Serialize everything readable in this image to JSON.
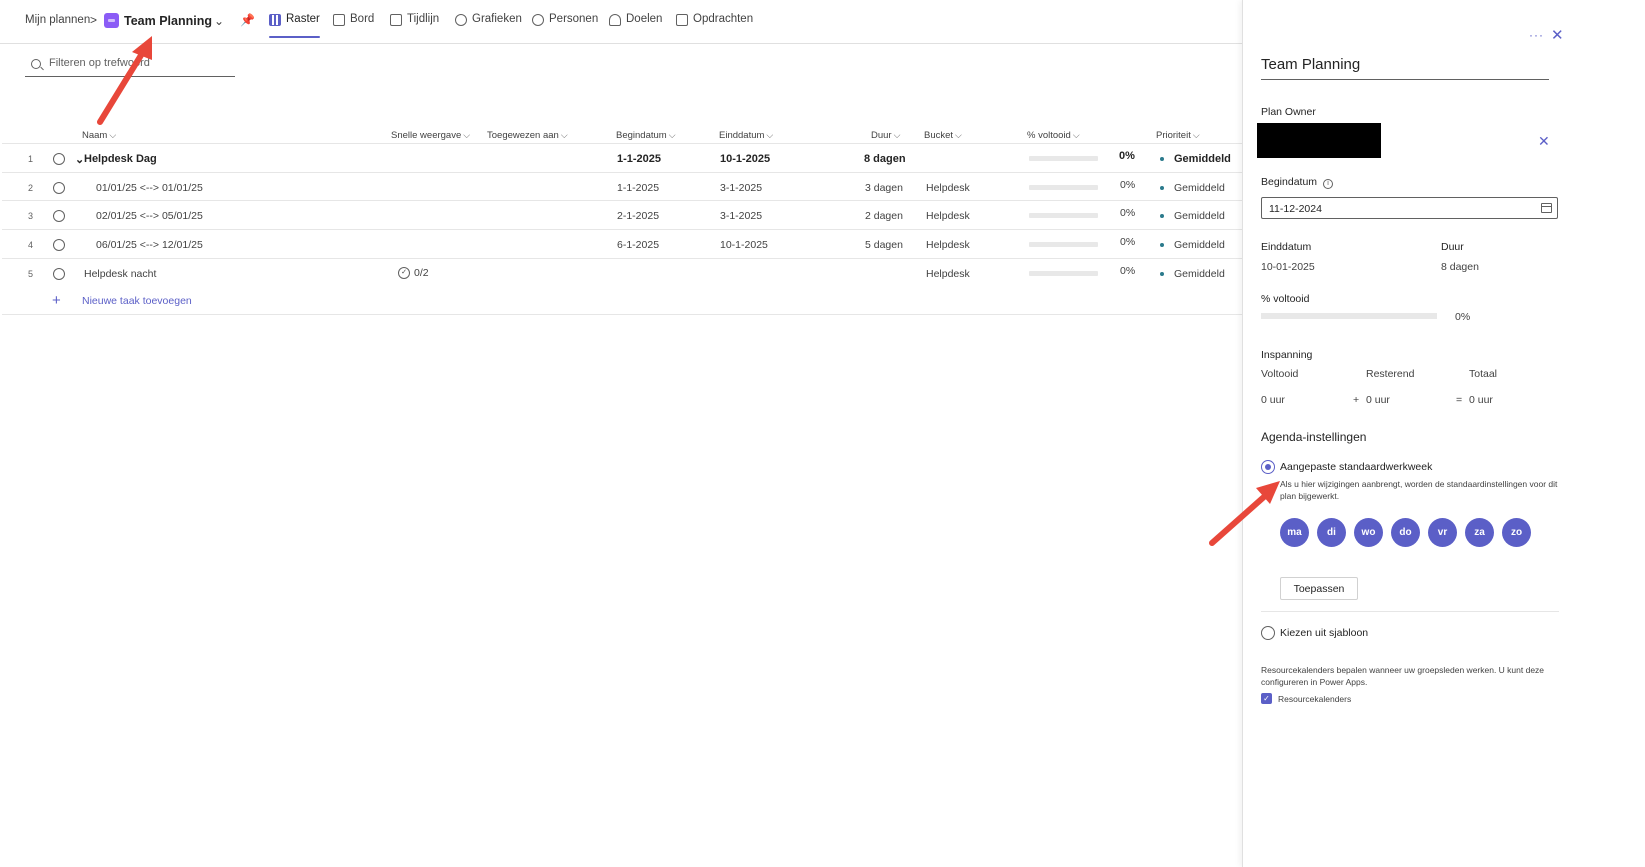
{
  "breadcrumb": {
    "root": "Mijn plannen",
    "separator": ">",
    "plan_name": "Team Planning"
  },
  "views": [
    {
      "label": "Raster",
      "icon": "grid-icon",
      "active": true
    },
    {
      "label": "Bord",
      "icon": "board-icon",
      "active": false
    },
    {
      "label": "Tijdlijn",
      "icon": "timeline-icon",
      "active": false
    },
    {
      "label": "Grafieken",
      "icon": "charts-icon",
      "active": false
    },
    {
      "label": "Personen",
      "icon": "people-icon",
      "active": false
    },
    {
      "label": "Doelen",
      "icon": "goals-icon",
      "active": false
    },
    {
      "label": "Opdrachten",
      "icon": "assignments-icon",
      "active": false
    }
  ],
  "filter": {
    "placeholder": "Filteren op trefwoord"
  },
  "columns": {
    "name": "Naam",
    "quick_view": "Snelle weergave",
    "assigned": "Toegewezen aan",
    "start": "Begindatum",
    "end": "Einddatum",
    "duration": "Duur",
    "bucket": "Bucket",
    "progress": "% voltooid",
    "priority": "Prioriteit"
  },
  "rows": [
    {
      "num": "1",
      "name": "Helpdesk Dag",
      "quick": "",
      "start": "1-1-2025",
      "end": "10-1-2025",
      "duration": "8 dagen",
      "bucket": "",
      "progress": "0%",
      "priority": "Gemiddeld",
      "summary": true
    },
    {
      "num": "2",
      "name": "01/01/25 <--> 01/01/25",
      "quick": "",
      "start": "1-1-2025",
      "end": "3-1-2025",
      "duration": "3 dagen",
      "bucket": "Helpdesk",
      "progress": "0%",
      "priority": "Gemiddeld"
    },
    {
      "num": "3",
      "name": "02/01/25 <--> 05/01/25",
      "quick": "",
      "start": "2-1-2025",
      "end": "3-1-2025",
      "duration": "2 dagen",
      "bucket": "Helpdesk",
      "progress": "0%",
      "priority": "Gemiddeld"
    },
    {
      "num": "4",
      "name": "06/01/25 <--> 12/01/25",
      "quick": "",
      "start": "6-1-2025",
      "end": "10-1-2025",
      "duration": "5 dagen",
      "bucket": "Helpdesk",
      "progress": "0%",
      "priority": "Gemiddeld"
    },
    {
      "num": "5",
      "name": "Helpdesk nacht",
      "quick": "0/2",
      "start": "",
      "end": "",
      "duration": "",
      "bucket": "Helpdesk",
      "progress": "0%",
      "priority": "Gemiddeld"
    }
  ],
  "add_task": "Nieuwe taak toevoegen",
  "panel": {
    "title": "Team Planning",
    "owner_label": "Plan Owner",
    "start_label": "Begindatum",
    "start_value": "11-12-2024",
    "end_label": "Einddatum",
    "end_value": "10-01-2025",
    "duration_label": "Duur",
    "duration_value": "8 dagen",
    "progress_label": "% voltooid",
    "progress_value": "0%",
    "effort_label": "Inspanning",
    "effort_done_label": "Voltooid",
    "effort_remaining_label": "Resterend",
    "effort_total_label": "Totaal",
    "effort_done": "0 uur",
    "effort_remaining": "0 uur",
    "effort_total": "0 uur",
    "plus": "+",
    "equals": "=",
    "agenda_label": "Agenda-instellingen",
    "custom_week_label": "Aangepaste standaardwerkweek",
    "custom_week_note": "Als u hier wijzigingen aanbrengt, worden de standaardinstellingen voor dit plan bijgewerkt.",
    "days": [
      "ma",
      "di",
      "wo",
      "do",
      "vr",
      "za",
      "zo"
    ],
    "apply_label": "Toepassen",
    "template_label": "Kiezen uit sjabloon",
    "resource_note": "Resourcekalenders bepalen wanneer uw groepsleden werken. U kunt deze configureren in Power Apps.",
    "resource_checkbox_label": "Resourcekalenders",
    "more": "···",
    "close": "✕"
  },
  "colors": {
    "accent": "#5b5fc7",
    "arrow": "#e8473a",
    "plan_icon": "#8b5cf6"
  }
}
